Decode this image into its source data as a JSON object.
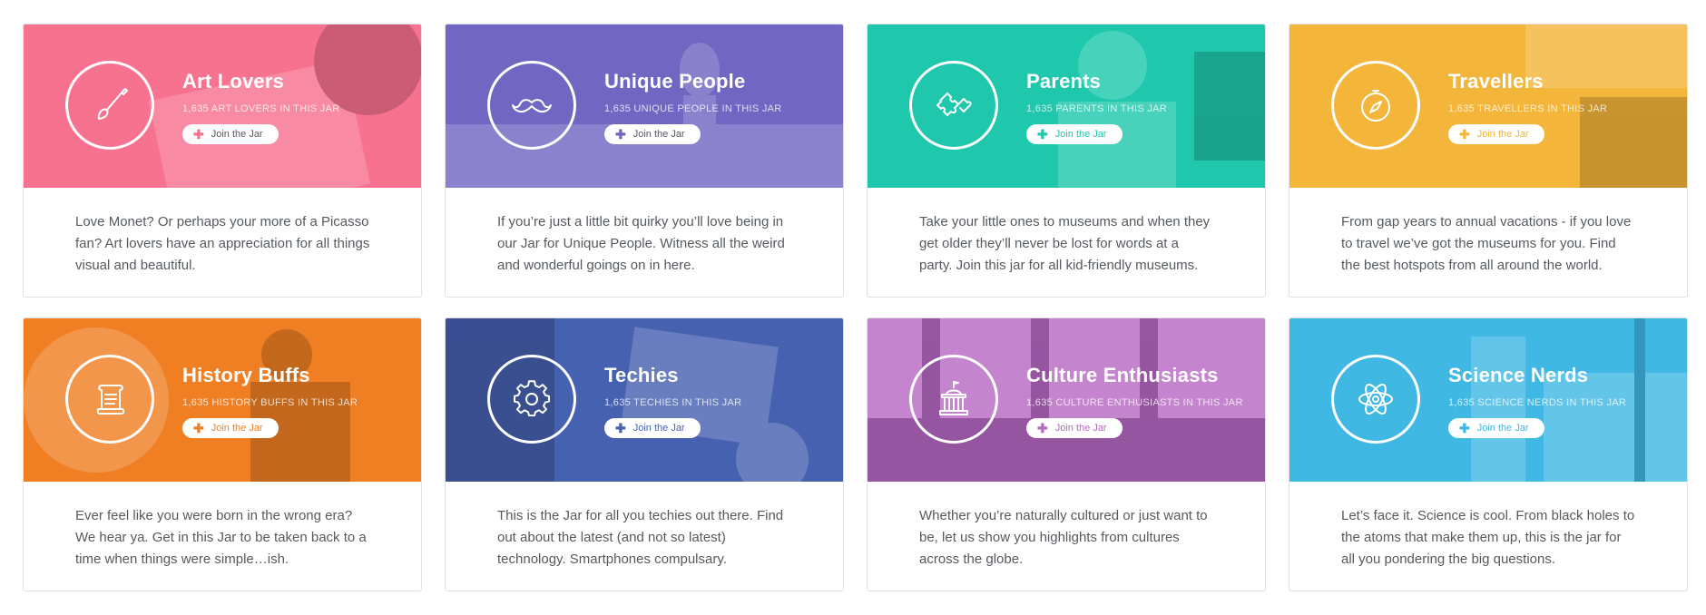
{
  "cards": [
    {
      "title": "Art Lovers",
      "count": "1,635 ART LOVERS IN THIS JAR",
      "button": "Join the Jar",
      "icon": "paintbrush-icon",
      "color": "#f7728f",
      "description": "Love Monet? Or perhaps your more of a Picasso fan? Art lovers have an appreciation for all things visual and beautiful."
    },
    {
      "title": "Unique People",
      "count": "1,635 UNIQUE PEOPLE IN THIS JAR",
      "button": "Join the Jar",
      "icon": "mustache-icon",
      "color": "#7166c2",
      "description": "If you’re just a little bit quirky you’ll love being in our Jar for Unique People. Witness all the weird and wonderful goings on in here."
    },
    {
      "title": "Parents",
      "count": "1,635 PARENTS IN THIS JAR",
      "button": "Join the Jar",
      "icon": "puzzle-icon",
      "color": "#1fc8ad",
      "description": "Take your little ones to museums and when they get older they’ll never be lost for words at a party. Join this jar for all kid-friendly museums."
    },
    {
      "title": "Travellers",
      "count": "1,635 TRAVELLERS IN THIS JAR",
      "button": "Join the Jar",
      "icon": "compass-icon",
      "color": "#f3b53a",
      "description": "From gap years to annual vacations - if you love to travel we’ve got the museums for you. Find the best hotspots from all around the world."
    },
    {
      "title": "History Buffs",
      "count": "1,635 HISTORY BUFFS IN THIS JAR",
      "button": "Join the Jar",
      "icon": "scroll-icon",
      "color": "#f07f24",
      "description": "Ever feel like you were born in the wrong era? We hear ya. Get in this Jar to be taken back to a time when things were simple…ish."
    },
    {
      "title": "Techies",
      "count": "1,635 TECHIES IN THIS JAR",
      "button": "Join the Jar",
      "icon": "gear-icon",
      "color": "#4761b1",
      "description": "This is the Jar for all you techies out there. Find out about the latest (and not so latest) technology. Smartphones compulsary."
    },
    {
      "title": "Culture Enthusiasts",
      "count": "1,635 CULTURE ENTHUSIASTS IN THIS JAR",
      "button": "Join the Jar",
      "icon": "museum-icon",
      "color": "#b869c4",
      "description": "Whether you’re naturally cultured or just want to be, let us show you highlights from cultures across the globe."
    },
    {
      "title": "Science Nerds",
      "count": "1,635 SCIENCE NERDS IN THIS JAR",
      "button": "Join the Jar",
      "icon": "atom-icon",
      "color": "#40b8e4",
      "description": "Let’s face it. Science is cool. From black holes to the atoms that make them up, this is the jar for all you pondering the big questions."
    }
  ]
}
